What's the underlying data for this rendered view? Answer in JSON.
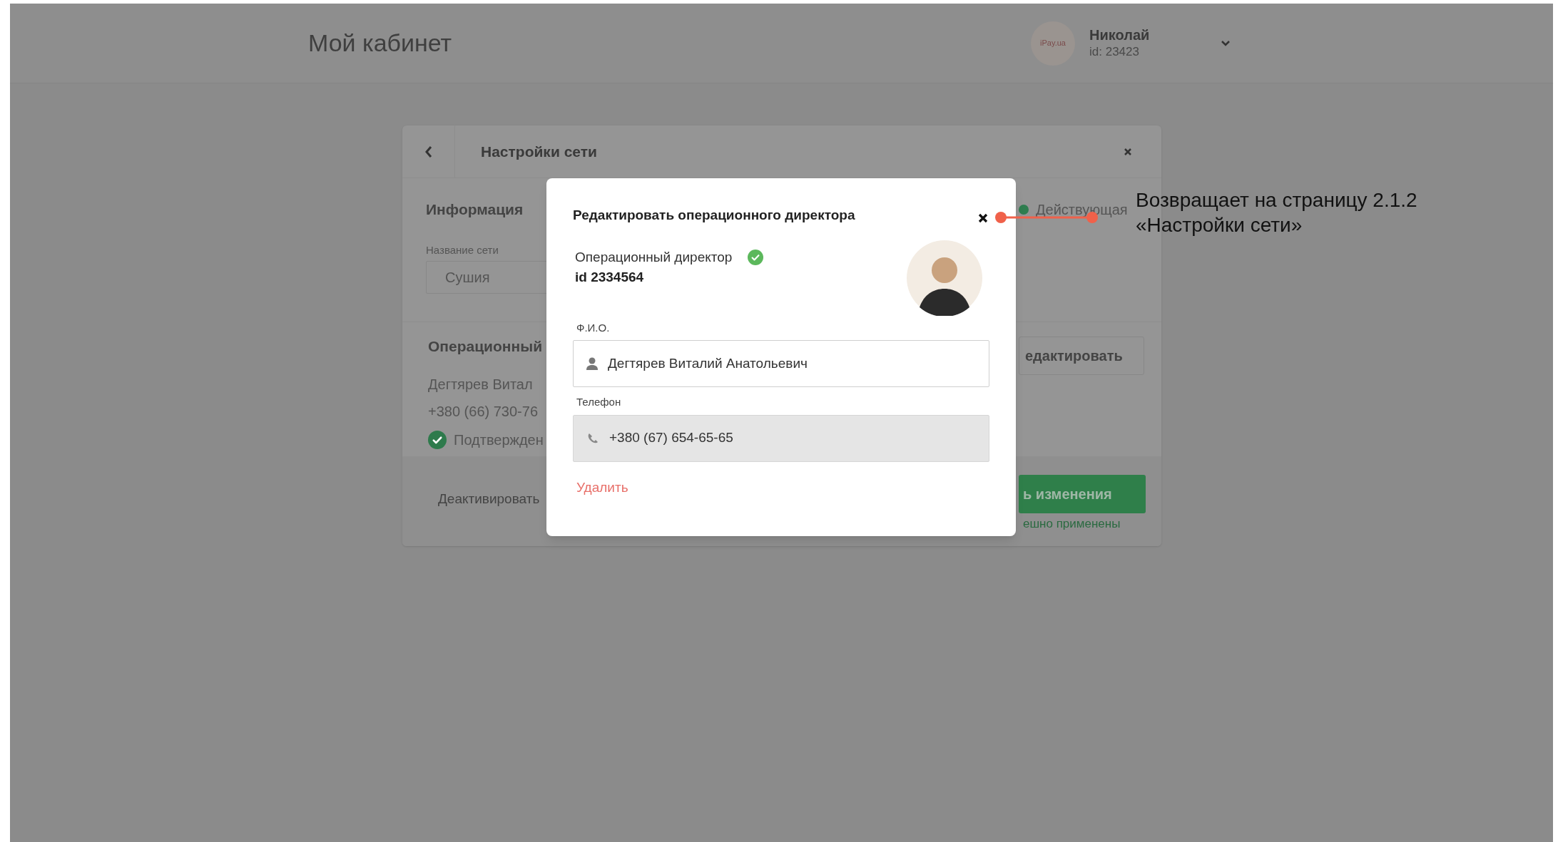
{
  "header": {
    "title": "Мой кабинет",
    "user": {
      "avatar_text": "iPay.ua",
      "name": "Николай",
      "id": "id: 23423"
    }
  },
  "settings_card": {
    "title": "Настройки сети",
    "info": {
      "heading": "Информация",
      "status": "Действующая",
      "network_label": "Название сети",
      "network_value": "Сушия"
    },
    "director": {
      "heading": "Операционный",
      "name": "Дегтярев Витал",
      "phone": "+380 (66) 730-76",
      "verified": true,
      "verified_label": "Подтвержден",
      "edit_button": "едактировать"
    },
    "footer": {
      "deactivate": "Деактивировать",
      "save_button": "ь изменения",
      "save_note": "ешно применены"
    }
  },
  "modal": {
    "title": "Редактировать операционного директора",
    "role": "Операционный директор",
    "verified": true,
    "id": "id 2334564",
    "fields": [
      {
        "kind": "name",
        "label": "Ф.И.О.",
        "value": "Дегтярев Виталий Анатольевич",
        "disabled": false
      },
      {
        "kind": "phone",
        "label": "Телефон",
        "value": "+380 (67) 654-65-65",
        "disabled": true
      }
    ],
    "delete_link": "Удалить"
  },
  "annotation": {
    "lines": [
      "Возвращает на страницу 2.1.2",
      "«Настройки сети»"
    ]
  }
}
